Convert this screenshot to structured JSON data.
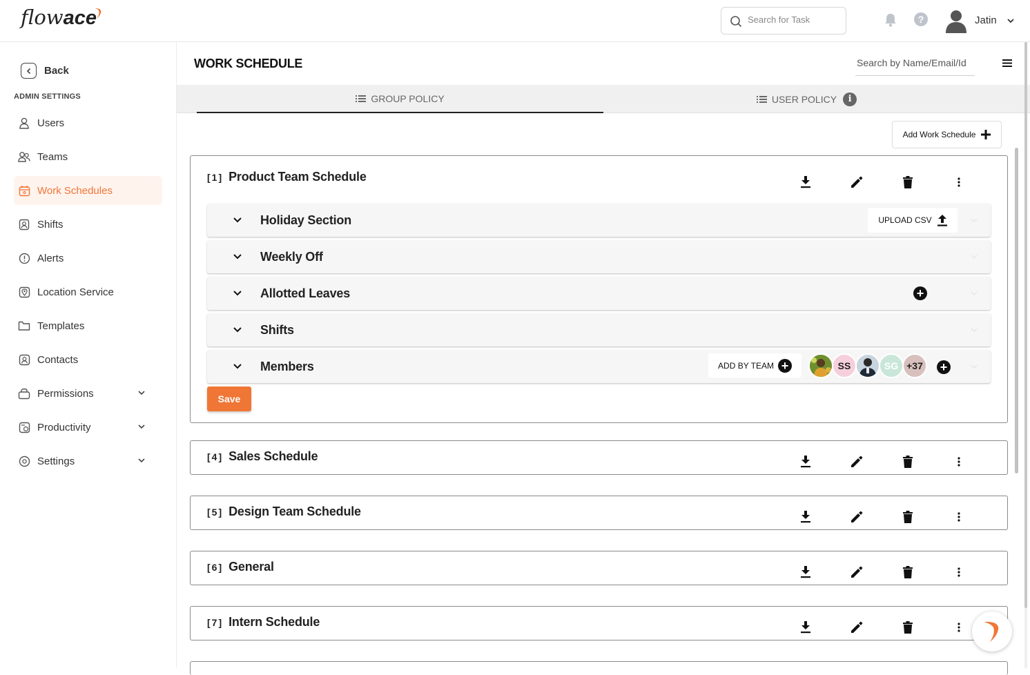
{
  "app": {
    "logo_light": "flow",
    "logo_bold": "ace",
    "brand_color": "#f07636"
  },
  "header": {
    "search_placeholder": "Search for Task",
    "user_name": "Jatin",
    "icons": [
      "search-icon",
      "bell-icon",
      "help-icon",
      "avatar",
      "chevron-down-icon"
    ]
  },
  "sidebar": {
    "back_label": "Back",
    "section_label": "ADMIN SETTINGS",
    "items": [
      {
        "label": "Users",
        "icon": "user-icon",
        "active": false
      },
      {
        "label": "Teams",
        "icon": "teams-icon",
        "active": false
      },
      {
        "label": "Work Schedules",
        "icon": "calendar-icon",
        "active": true
      },
      {
        "label": "Shifts",
        "icon": "shift-icon",
        "active": false
      },
      {
        "label": "Alerts",
        "icon": "alert-icon",
        "active": false
      },
      {
        "label": "Location Service",
        "icon": "location-icon",
        "active": false
      },
      {
        "label": "Templates",
        "icon": "folder-icon",
        "active": false
      },
      {
        "label": "Contacts",
        "icon": "contacts-icon",
        "active": false
      },
      {
        "label": "Permissions",
        "icon": "lock-icon",
        "active": false,
        "expandable": true
      },
      {
        "label": "Productivity",
        "icon": "productivity-icon",
        "active": false,
        "expandable": true
      },
      {
        "label": "Settings",
        "icon": "gear-icon",
        "active": false,
        "expandable": true
      }
    ]
  },
  "main": {
    "title": "WORK SCHEDULE",
    "search_placeholder": "Search by Name/Email/Id",
    "tabs": [
      {
        "label": "GROUP POLICY",
        "active": true
      },
      {
        "label": "USER POLICY",
        "active": false,
        "info": "i"
      }
    ],
    "add_button_label": "Add Work Schedule",
    "schedules": [
      {
        "num": "[1]",
        "title": "Product Team Schedule",
        "expanded": true,
        "sections": [
          {
            "label": "Holiday Section",
            "action": "UPLOAD CSV"
          },
          {
            "label": "Weekly Off"
          },
          {
            "label": "Allotted Leaves"
          },
          {
            "label": "Shifts"
          },
          {
            "label": "Members",
            "action": "ADD BY TEAM"
          }
        ],
        "members": [
          {
            "initials": "",
            "kind": "photo-1"
          },
          {
            "initials": "SS",
            "bg": "#f5d0dc",
            "fg": "#222"
          },
          {
            "initials": "",
            "kind": "photo-2"
          },
          {
            "initials": "SG",
            "bg": "#c9e7d9",
            "fg": "#fff"
          },
          {
            "initials": "+37",
            "bg": "#d8c0bc",
            "fg": "#222"
          }
        ],
        "save_label": "Save"
      },
      {
        "num": "[4]",
        "title": "Sales Schedule"
      },
      {
        "num": "[5]",
        "title": "Design Team Schedule"
      },
      {
        "num": "[6]",
        "title": "General"
      },
      {
        "num": "[7]",
        "title": "Intern Schedule"
      }
    ]
  }
}
